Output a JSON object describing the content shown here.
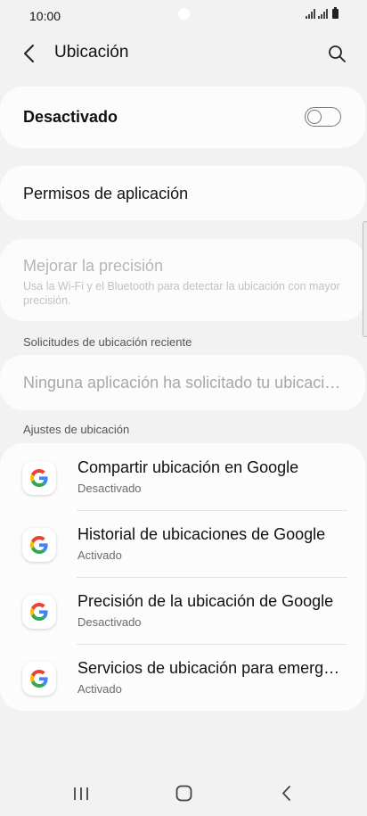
{
  "status_bar": {
    "time": "10:00"
  },
  "header": {
    "title": "Ubicación"
  },
  "location_toggle": {
    "label": "Desactivado",
    "state": "off"
  },
  "app_permissions": {
    "label": "Permisos de aplicación"
  },
  "improve_accuracy": {
    "title": "Mejorar la precisión",
    "description": "Usa la Wi-Fi y el Bluetooth para detectar la ubicación con mayor precisión.",
    "enabled": false
  },
  "recent_requests": {
    "header": "Solicitudes de ubicación reciente",
    "empty_text": "Ninguna aplicación ha solicitado tu ubicación recientemente"
  },
  "location_settings": {
    "header": "Ajustes de ubicación",
    "items": [
      {
        "title": "Compartir ubicación en Google",
        "subtitle": "Desactivado",
        "icon": "google-icon"
      },
      {
        "title": "Historial de ubicaciones de Google",
        "subtitle": "Activado",
        "icon": "google-icon"
      },
      {
        "title": "Precisión de la ubicación de Google",
        "subtitle": "Desactivado",
        "icon": "google-icon"
      },
      {
        "title": "Servicios de ubicación para emergencias",
        "subtitle": "Activado",
        "icon": "google-icon"
      }
    ]
  },
  "colors": {
    "background": "#f2f2f2",
    "card": "#fcfcfc",
    "disabled_text": "#b5b5b5",
    "google_blue": "#4285F4",
    "google_red": "#EA4335",
    "google_yellow": "#FBBC05",
    "google_green": "#34A853"
  }
}
